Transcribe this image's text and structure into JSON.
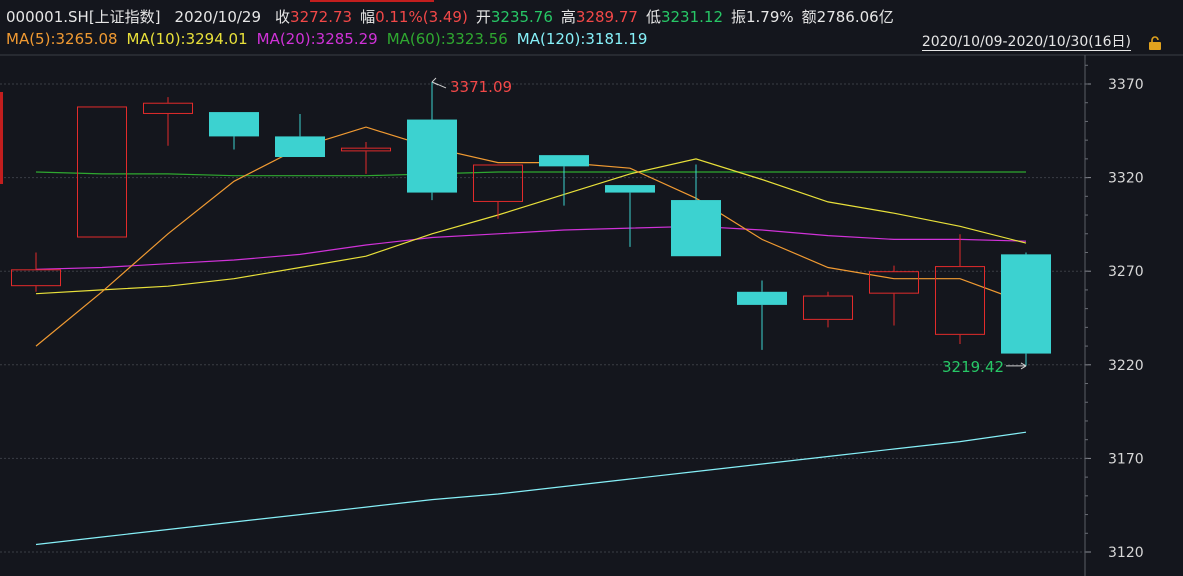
{
  "header": {
    "code": "000001.SH[上证指数]",
    "date": "2020/10/29",
    "close_label": "收",
    "close_value": "3272.73",
    "change_label": "幅",
    "change_value": "0.11%(3.49)",
    "open_label": "开",
    "open_value": "3235.76",
    "high_label": "高",
    "high_value": "3289.77",
    "low_label": "低",
    "low_value": "3231.12",
    "amp_label": "振",
    "amp_value": "1.79%",
    "amount_label": "额",
    "amount_value": "2786.06亿"
  },
  "ma_legend": {
    "ma5": "MA(5):3265.08",
    "ma10": "MA(10):3294.01",
    "ma20": "MA(20):3285.29",
    "ma60": "MA(60):3323.56",
    "ma120": "MA(120):3181.19"
  },
  "range_label": "2020/10/09-2020/10/30(16日)",
  "colors": {
    "background": "#14161d",
    "up": "#e22b2b",
    "down": "#3cd2d0",
    "ma5": "#f09a32",
    "ma10": "#e8e03a",
    "ma20": "#d032d8",
    "ma60": "#2fa830",
    "ma120": "#86f0f8",
    "grid": "#3a3d45"
  },
  "chart_data": {
    "type": "candlestick",
    "y_ticks": [
      "3370",
      "3320",
      "3270",
      "3220",
      "3170",
      "3120"
    ],
    "ylim": [
      3110,
      3395
    ],
    "candles": [
      {
        "open": 3262,
        "close": 3271,
        "high": 3280,
        "low": 3259
      },
      {
        "open": 3288,
        "close": 3358,
        "high": 3358,
        "low": 3288
      },
      {
        "open": 3354,
        "close": 3360,
        "high": 3363,
        "low": 3337
      },
      {
        "open": 3355,
        "close": 3342,
        "high": 3355,
        "low": 3335
      },
      {
        "open": 3342,
        "close": 3331,
        "high": 3354,
        "low": 3331
      },
      {
        "open": 3334,
        "close": 3336,
        "high": 3339,
        "low": 3322
      },
      {
        "open": 3351,
        "close": 3312,
        "high": 3371.09,
        "low": 3308
      },
      {
        "open": 3307,
        "close": 3327,
        "high": 3327,
        "low": 3298
      },
      {
        "open": 3332,
        "close": 3326,
        "high": 3332,
        "low": 3305
      },
      {
        "open": 3316,
        "close": 3312,
        "high": 3316,
        "low": 3283
      },
      {
        "open": 3308,
        "close": 3278,
        "high": 3327,
        "low": 3278
      },
      {
        "open": 3259,
        "close": 3252,
        "high": 3265,
        "low": 3228
      },
      {
        "open": 3244,
        "close": 3257,
        "high": 3259,
        "low": 3240
      },
      {
        "open": 3258,
        "close": 3270,
        "high": 3273,
        "low": 3241
      },
      {
        "open": 3236,
        "close": 3272.73,
        "high": 3289.77,
        "low": 3231.12
      },
      {
        "open": 3279,
        "close": 3226,
        "high": 3280,
        "low": 3219.42
      }
    ],
    "ma5": [
      3230,
      null,
      null,
      null,
      null,
      null,
      null,
      null,
      null,
      null,
      null,
      null,
      null,
      null,
      null,
      3253
    ],
    "ma5_points": [
      3230,
      3259,
      3290,
      3318,
      3336,
      3347,
      3336,
      3328,
      3328,
      3325,
      3309,
      3287,
      3272,
      3266,
      3266,
      3253
    ],
    "ma10_points": [
      3258,
      3260,
      3262,
      3266,
      3272,
      3278,
      3290,
      3300,
      3311,
      3322,
      3330,
      3319,
      3307,
      3301,
      3294,
      3285
    ],
    "ma20_points": [
      3271,
      3272,
      3274,
      3276,
      3279,
      3284,
      3288,
      3290,
      3292,
      3293,
      3294,
      3292,
      3289,
      3287,
      3287,
      3286
    ],
    "ma60_points": [
      3323,
      3322,
      3322,
      3321,
      3321,
      3321,
      3322,
      3323,
      3323,
      3323,
      3323,
      3323,
      3323,
      3323,
      3323,
      3323
    ],
    "ma120_points": [
      3124,
      3128,
      3132,
      3136,
      3140,
      3144,
      3148,
      3151,
      3155,
      3159,
      3163,
      3167,
      3171,
      3175,
      3179,
      3184
    ],
    "annotations": {
      "high_label": "3371.09",
      "low_label": "3219.42"
    }
  }
}
